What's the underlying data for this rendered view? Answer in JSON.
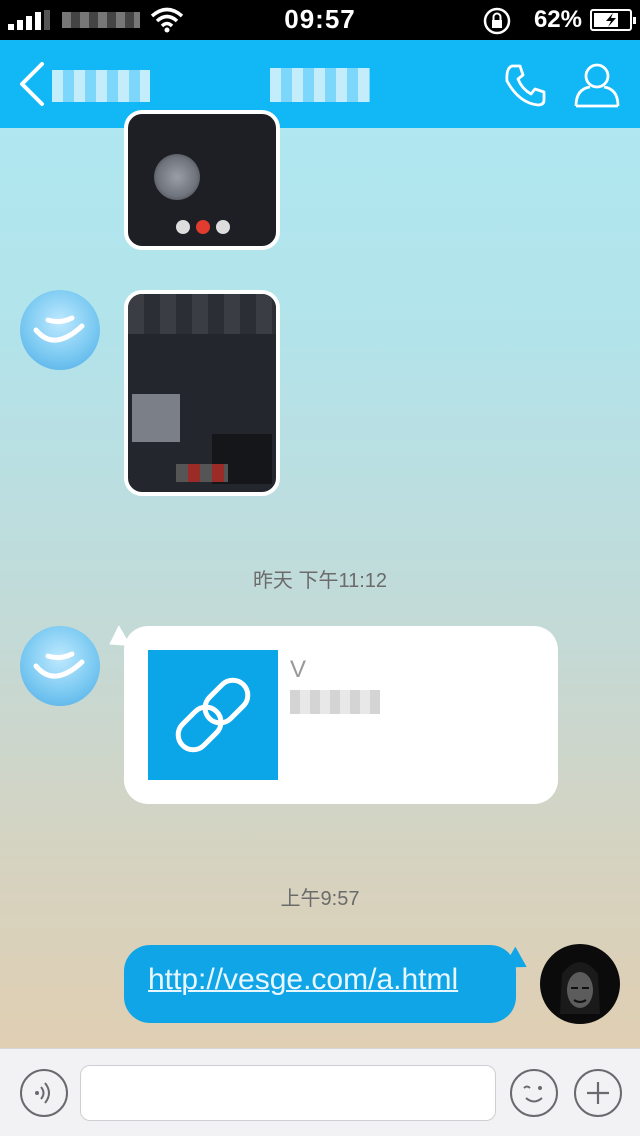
{
  "status_bar": {
    "time": "09:57",
    "battery_percent": "62%",
    "signal_bars": 4
  },
  "navbar": {
    "back_icon": "chevron-left-icon",
    "call_icon": "phone-icon",
    "profile_icon": "person-icon"
  },
  "messages": {
    "timestamp_1": "昨天 下午11:12",
    "link_card": {
      "title": "V",
      "icon": "link-icon"
    },
    "timestamp_2": "上午9:57",
    "sent_link": "http://vesge.com/a.html"
  },
  "input_bar": {
    "voice_icon": "voice-icon",
    "emoji_icon": "emoji-icon",
    "plus_icon": "plus-icon",
    "input_value": ""
  },
  "colors": {
    "nav": "#12b7f5",
    "sent_bubble": "#10a5e6",
    "link_thumb": "#0aa6e8"
  }
}
